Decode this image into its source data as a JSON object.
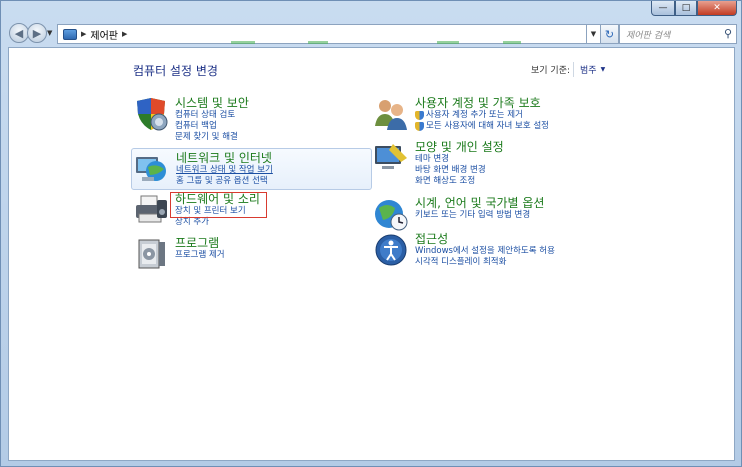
{
  "window": {
    "caption_minimize": "—",
    "caption_maximize": "□",
    "caption_close": "✕"
  },
  "toolbar": {
    "back_symbol": "◀",
    "forward_symbol": "▶",
    "breadcrumb_arrow": "▶",
    "breadcrumb_item": "제어판",
    "dropdown_arrow": "▼",
    "refresh_symbol": "↻",
    "search_placeholder": "제어판 검색",
    "search_symbol": "⚲"
  },
  "page": {
    "title": "컴퓨터 설정 변경",
    "view_by_label": "보기 기준:",
    "view_by_value": "범주",
    "view_by_caret": "▼"
  },
  "categories": [
    {
      "id": "system",
      "title": "시스템 및 보안",
      "links": [
        "컴퓨터 상태 검토",
        "컴퓨터 백업",
        "문제 찾기 및 해결"
      ]
    },
    {
      "id": "network",
      "title": "네트워크 및 인터넷",
      "links": [
        "네트워크 상태 및 작업 보기",
        "홈 그룹 및 공유 옵션 선택"
      ]
    },
    {
      "id": "hardware",
      "title": "하드웨어 및 소리",
      "links": [
        "장치 및 프린터 보기",
        "장치 추가"
      ]
    },
    {
      "id": "programs",
      "title": "프로그램",
      "links": [
        "프로그램 제거"
      ]
    },
    {
      "id": "users",
      "title": "사용자 계정 및 가족 보호",
      "links": [
        "사용자 계정 추가 또는 제거",
        "모든 사용자에 대해 자녀 보호 설정"
      ]
    },
    {
      "id": "appearance",
      "title": "모양 및 개인 설정",
      "links": [
        "테마 변경",
        "바탕 화면 배경 변경",
        "화면 해상도 조정"
      ]
    },
    {
      "id": "clock",
      "title": "시계, 언어 및 국가별 옵션",
      "links": [
        "키보드 또는 기타 입력 방법 변경"
      ]
    },
    {
      "id": "ease",
      "title": "접근성",
      "links": [
        "Windows에서 설정을 제안하도록 허용",
        "시각적 디스플레이 최적화"
      ]
    }
  ]
}
